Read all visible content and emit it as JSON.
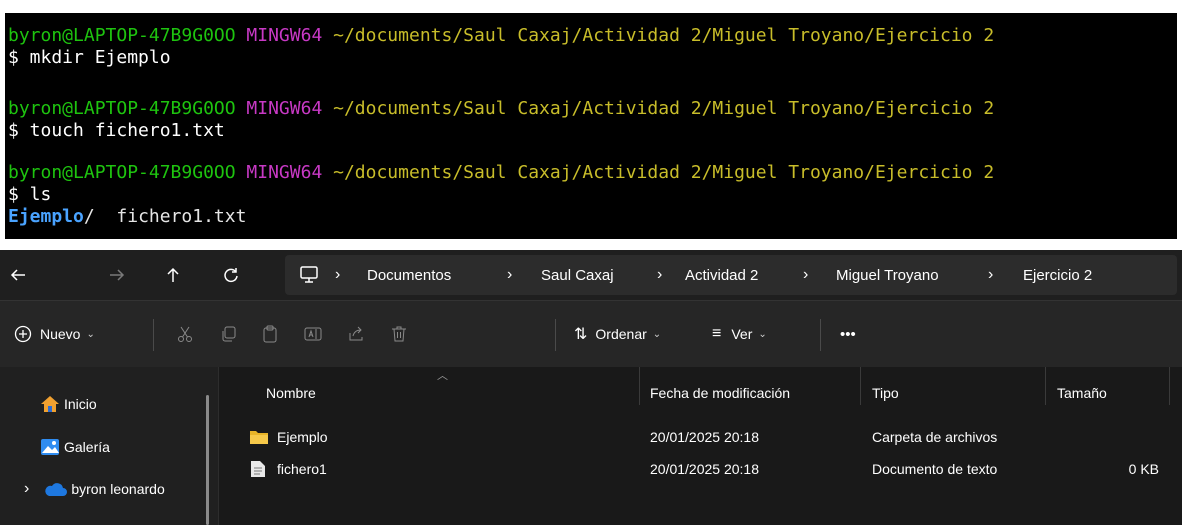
{
  "terminal": {
    "lines": [
      {
        "user": "byron@LAPTOP-47B9G0OO",
        "shell": "MINGW64",
        "path": "~/documents/Saul Caxaj/Actividad 2/Miguel Troyano/Ejercicio 2",
        "command": "$ mkdir Ejemplo"
      },
      {
        "user": "byron@LAPTOP-47B9G0OO",
        "shell": "MINGW64",
        "path": "~/documents/Saul Caxaj/Actividad 2/Miguel Troyano/Ejercicio 2",
        "command": "$ touch fichero1.txt"
      },
      {
        "user": "byron@LAPTOP-47B9G0OO",
        "shell": "MINGW64",
        "path": "~/documents/Saul Caxaj/Actividad 2/Miguel Troyano/Ejercicio 2",
        "command": "$ ls"
      }
    ],
    "ls_output": {
      "dir": "Ejemplo",
      "dir_suffix": "/",
      "file": "fichero1.txt"
    },
    "colors": {
      "user": "#1ec40f",
      "shell": "#c839c5",
      "path": "#c8bd2a",
      "dir": "#4aa3ff"
    }
  },
  "explorer": {
    "nav": {
      "back_icon": "arrow-left-icon",
      "forward_icon": "arrow-right-icon",
      "up_icon": "arrow-up-icon",
      "refresh_icon": "refresh-icon",
      "pc_icon": "monitor-icon"
    },
    "breadcrumb": [
      "Documentos",
      "Saul Caxaj",
      "Actividad 2",
      "Miguel Troyano",
      "Ejercicio 2"
    ],
    "toolbar": {
      "new_label": "Nuevo",
      "sort_label": "Ordenar",
      "view_label": "Ver",
      "more_label": "•••",
      "icons": [
        "cut-icon",
        "copy-icon",
        "paste-icon",
        "rename-icon",
        "share-icon",
        "delete-icon"
      ]
    },
    "sidebar": {
      "items": [
        {
          "label": "Inicio",
          "icon": "home-icon"
        },
        {
          "label": "Galería",
          "icon": "gallery-icon"
        },
        {
          "label": "byron leonardo",
          "icon": "cloud-icon"
        }
      ]
    },
    "columns": {
      "name": "Nombre",
      "modified": "Fecha de modificación",
      "type": "Tipo",
      "size": "Tamaño"
    },
    "rows": [
      {
        "name": "Ejemplo",
        "modified": "20/01/2025 20:18",
        "type": "Carpeta de archivos",
        "size": "",
        "icon": "folder-icon"
      },
      {
        "name": "fichero1",
        "modified": "20/01/2025 20:18",
        "type": "Documento de texto",
        "size": "0 KB",
        "icon": "text-file-icon"
      }
    ]
  }
}
